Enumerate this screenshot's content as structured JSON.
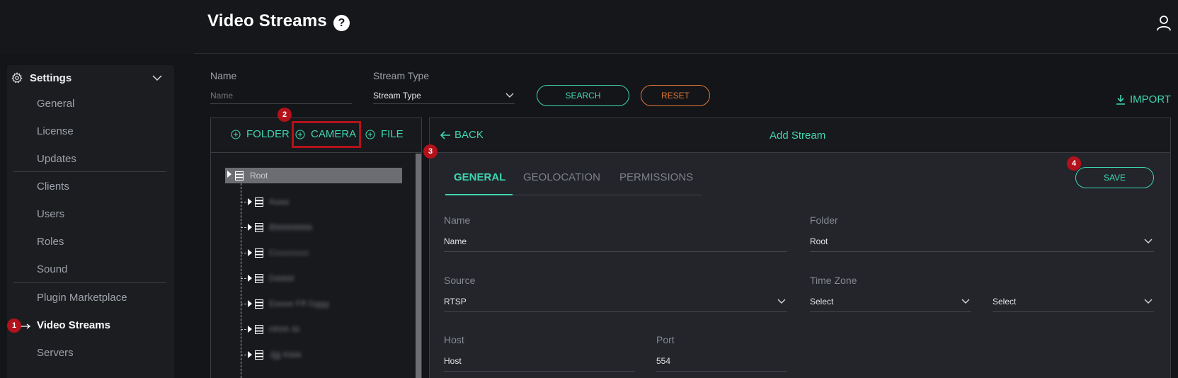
{
  "header": {
    "title": "Video Streams",
    "help": "?"
  },
  "sidebar": {
    "section": "Settings",
    "items": [
      {
        "label": "General"
      },
      {
        "label": "License"
      },
      {
        "label": "Updates"
      },
      {
        "label": "Clients"
      },
      {
        "label": "Users"
      },
      {
        "label": "Roles"
      },
      {
        "label": "Sound"
      },
      {
        "label": "Plugin Marketplace"
      },
      {
        "label": "Video Streams"
      },
      {
        "label": "Servers"
      }
    ]
  },
  "filters": {
    "name_label": "Name",
    "name_value": "Name",
    "type_label": "Stream Type",
    "type_value": "Stream Type",
    "search": "SEARCH",
    "reset": "RESET",
    "import": "IMPORT"
  },
  "tree_toolbar": {
    "folder": "FOLDER",
    "camera": "CAMERA",
    "file": "FILE"
  },
  "tree": {
    "root": "Root",
    "children": [
      "Aaaa",
      "Bbbbbbbbb",
      "Ccccccccc",
      "Ddddd",
      "Eeeee Fff Gggg",
      "Hhhh Iiii",
      "Jjjjj Kkkk"
    ]
  },
  "badges": [
    "1",
    "2",
    "3",
    "4"
  ],
  "panel": {
    "back": "BACK",
    "title": "Add Stream",
    "tabs": [
      "GENERAL",
      "GEOLOCATION",
      "PERMISSIONS"
    ],
    "save": "SAVE",
    "fields": {
      "name_label": "Name",
      "name_value": "Name",
      "folder_label": "Folder",
      "folder_value": "Root",
      "source_label": "Source",
      "source_value": "RTSP",
      "timezone_label": "Time Zone",
      "timezone_value_1": "Select",
      "timezone_value_2": "Select",
      "host_label": "Host",
      "host_value": "Host",
      "port_label": "Port",
      "port_value": "554"
    }
  },
  "colors": {
    "accent": "#3fd6b2",
    "warning": "#e0763a",
    "highlight": "#b3121b"
  }
}
